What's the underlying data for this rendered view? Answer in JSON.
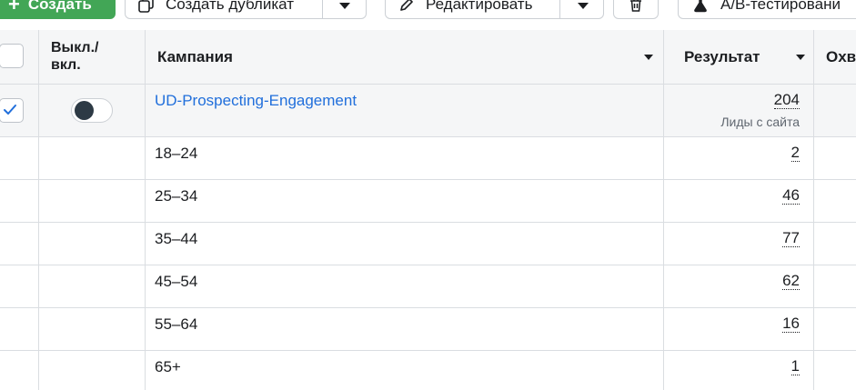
{
  "toolbar": {
    "create_label": "Создать",
    "duplicate_label": "Создать дубликат",
    "edit_label": "Редактировать",
    "ab_label": "A/B-тестировани"
  },
  "table": {
    "headers": {
      "toggle": "Выкл./вкл.",
      "campaign": "Кампания",
      "result": "Результат",
      "reach": "Охв"
    },
    "campaign_row": {
      "name": "UD-Prospecting-Engagement",
      "result": "204",
      "result_type": "Лиды с сайта",
      "toggle_on": false,
      "selected": true
    },
    "breakdown_rows": [
      {
        "age": "18–24",
        "result": "2"
      },
      {
        "age": "25–34",
        "result": "46"
      },
      {
        "age": "35–44",
        "result": "77"
      },
      {
        "age": "45–54",
        "result": "62"
      },
      {
        "age": "55–64",
        "result": "16"
      },
      {
        "age": "65+",
        "result": "1"
      }
    ]
  },
  "colors": {
    "primary": "#42a656",
    "link": "#216fdb",
    "border": "#dadde1",
    "header_bg": "#f5f6f7"
  }
}
